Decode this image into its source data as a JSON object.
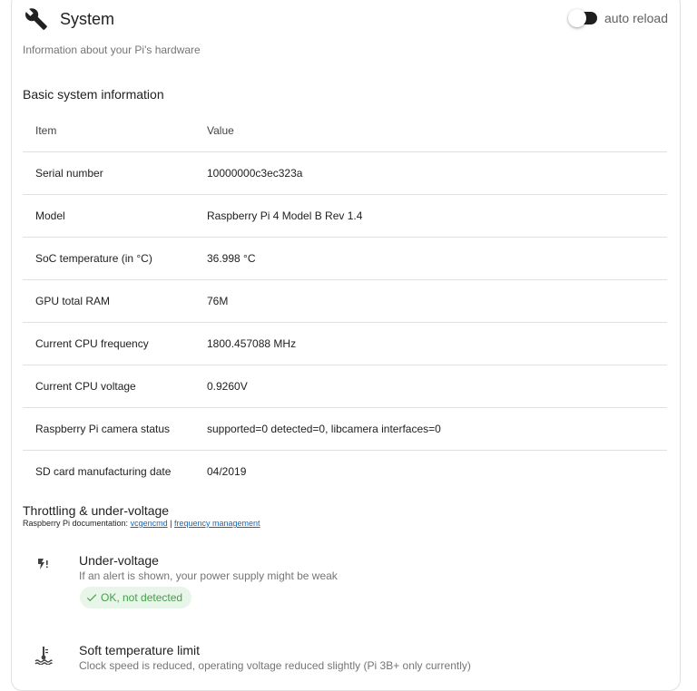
{
  "header": {
    "title": "System",
    "icon": "wrench-icon"
  },
  "auto_reload": {
    "label": "auto reload",
    "enabled": false
  },
  "subtitle": "Information about your Pi's hardware",
  "basic_section": {
    "title": "Basic system information",
    "columns": [
      "Item",
      "Value"
    ],
    "rows": [
      [
        "Serial number",
        "10000000c3ec323a"
      ],
      [
        "Model",
        "Raspberry Pi 4 Model B Rev 1.4"
      ],
      [
        "SoC temperature (in °C)",
        "36.998 °C"
      ],
      [
        "GPU total RAM",
        "76M"
      ],
      [
        "Current CPU frequency",
        "1800.457088 MHz"
      ],
      [
        "Current CPU voltage",
        "0.9260V"
      ],
      [
        "Raspberry Pi camera status",
        "supported=0 detected=0, libcamera interfaces=0"
      ],
      [
        "SD card manufacturing date",
        "04/2019"
      ]
    ]
  },
  "throttling": {
    "title": "Throttling & under-voltage",
    "docs_prefix": "Raspberry Pi documentation: ",
    "link1": "vcgencmd",
    "separator": " | ",
    "link2": "frequency management",
    "alerts": [
      {
        "icon": "low-power-icon",
        "title": "Under-voltage",
        "description": "If an alert is shown, your power supply might be weak",
        "status": "OK, not detected",
        "status_color": "#43a047"
      },
      {
        "icon": "thermostat-heat-icon",
        "title": "Soft temperature limit",
        "description": "Clock speed is reduced, operating voltage reduced slightly (Pi 3B+ only currently)"
      }
    ]
  }
}
